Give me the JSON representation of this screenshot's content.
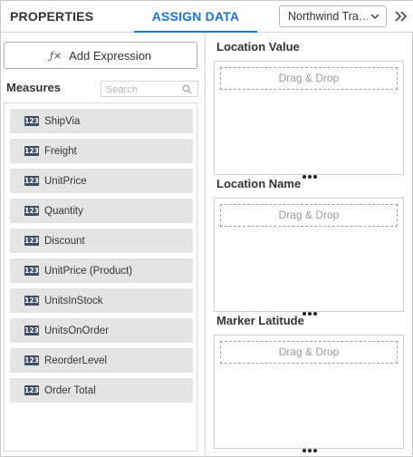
{
  "header": {
    "tab_properties": "PROPERTIES",
    "tab_assign_data": "ASSIGN DATA",
    "datasource_value": "Northwind Tra…",
    "accent_color": "#1a73d9"
  },
  "left_panel": {
    "add_expression_label": "Add Expression",
    "fx_symbol": "ƒ×",
    "measures_title": "Measures",
    "search_placeholder": "Search",
    "badge_text": "123",
    "measures": [
      "ShipVia",
      "Freight",
      "UnitPrice",
      "Quantity",
      "Discount",
      "UnitPrice (Product)",
      "UnitsInStock",
      "UnitsOnOrder",
      "ReorderLevel",
      "Order Total"
    ]
  },
  "right_panel": {
    "sections": [
      {
        "title": "Location Value",
        "drop_text": "Drag & Drop"
      },
      {
        "title": "Location Name",
        "drop_text": "Drag & Drop"
      },
      {
        "title": "Marker Latitude",
        "drop_text": "Drag & Drop"
      }
    ]
  },
  "icons": {
    "chevron": "chevron-down-icon",
    "collapse": "double-chevron-right-icon",
    "search": "search-icon",
    "field_type": "numeric-type-icon",
    "more": "more-dots-icon"
  }
}
